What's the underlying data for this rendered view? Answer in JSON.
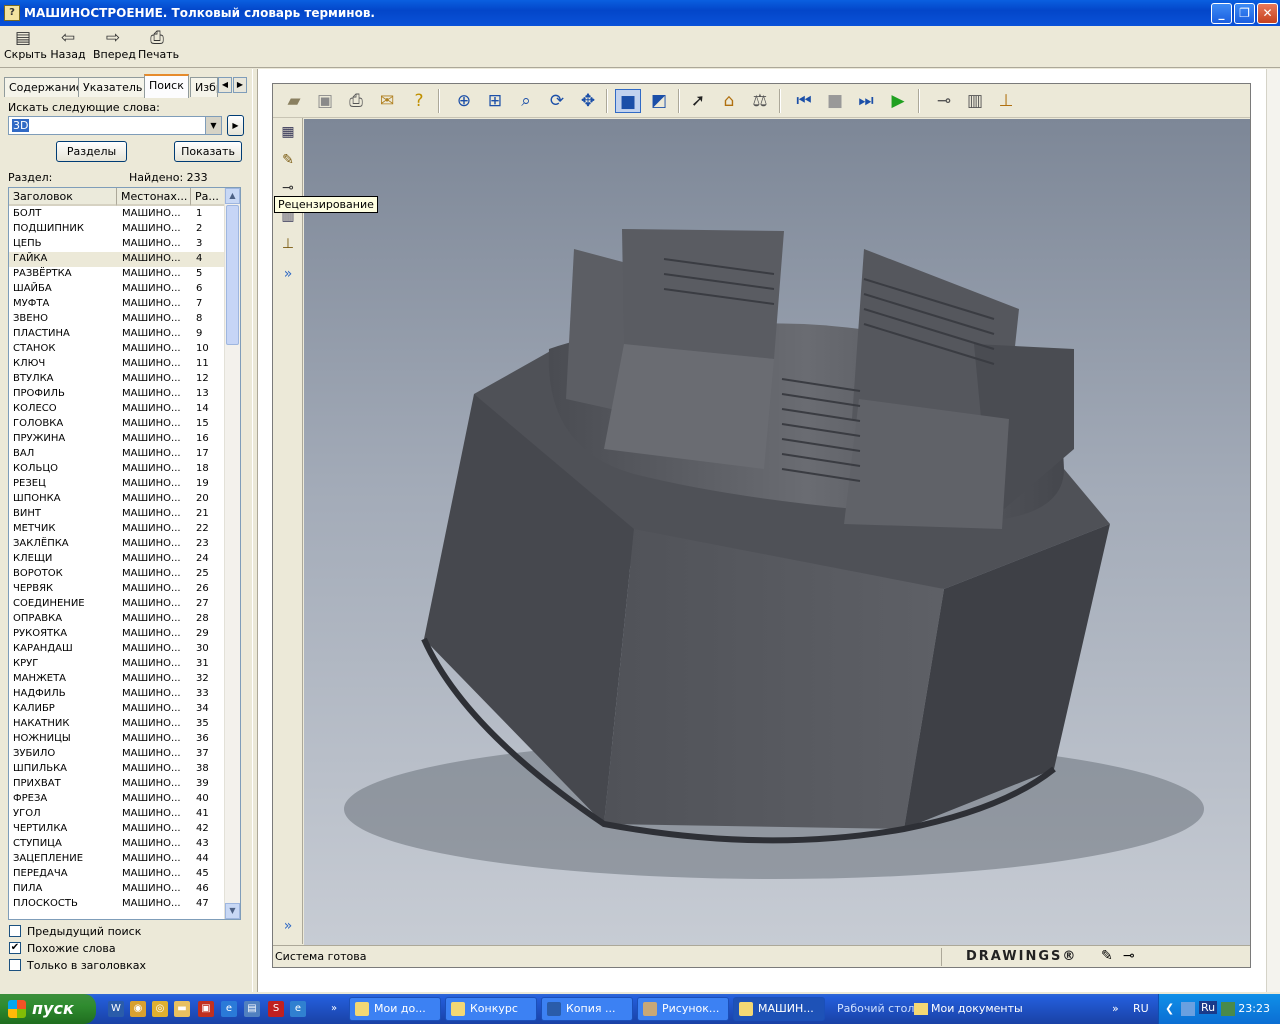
{
  "window": {
    "title": "МАШИНОСТРОЕНИЕ. Толковый словарь терминов.",
    "controls": {
      "minimize": "_",
      "maximize": "❐",
      "close": "✕"
    }
  },
  "toolbar": {
    "hide": "Скрыть",
    "back": "Назад",
    "forward": "Вперед",
    "print": "Печать"
  },
  "nav_tabs": [
    "Содержание",
    "Указатель",
    "Поиск",
    "Избр"
  ],
  "search": {
    "label": "Искать следующие слова:",
    "value": "3D",
    "sections_button": "Разделы",
    "show_button": "Показать",
    "section_label": "Раздел:",
    "found": "Найдено: 233"
  },
  "results": {
    "columns": [
      "Заголовок",
      "Местонах...",
      "Ра..."
    ],
    "selected_index": 3,
    "rows": [
      [
        "БОЛТ",
        "МАШИНО...",
        "1"
      ],
      [
        "ПОДШИПНИК",
        "МАШИНО...",
        "2"
      ],
      [
        "ЦЕПЬ",
        "МАШИНО...",
        "3"
      ],
      [
        "ГАЙКА",
        "МАШИНО...",
        "4"
      ],
      [
        "РАЗВЁРТКА",
        "МАШИНО...",
        "5"
      ],
      [
        "ШАЙБА",
        "МАШИНО...",
        "6"
      ],
      [
        "МУФТА",
        "МАШИНО...",
        "7"
      ],
      [
        "ЗВЕНО",
        "МАШИНО...",
        "8"
      ],
      [
        "ПЛАСТИНА",
        "МАШИНО...",
        "9"
      ],
      [
        "СТАНОК",
        "МАШИНО...",
        "10"
      ],
      [
        "КЛЮЧ",
        "МАШИНО...",
        "11"
      ],
      [
        "ВТУЛКА",
        "МАШИНО...",
        "12"
      ],
      [
        "ПРОФИЛЬ",
        "МАШИНО...",
        "13"
      ],
      [
        "КОЛЕСО",
        "МАШИНО...",
        "14"
      ],
      [
        "ГОЛОВКА",
        "МАШИНО...",
        "15"
      ],
      [
        "ПРУЖИНА",
        "МАШИНО...",
        "16"
      ],
      [
        "ВАЛ",
        "МАШИНО...",
        "17"
      ],
      [
        "КОЛЬЦО",
        "МАШИНО...",
        "18"
      ],
      [
        "РЕЗЕЦ",
        "МАШИНО...",
        "19"
      ],
      [
        "ШПОНКА",
        "МАШИНО...",
        "20"
      ],
      [
        "ВИНТ",
        "МАШИНО...",
        "21"
      ],
      [
        "МЕТЧИК",
        "МАШИНО...",
        "22"
      ],
      [
        "ЗАКЛЁПКА",
        "МАШИНО...",
        "23"
      ],
      [
        "КЛЕЩИ",
        "МАШИНО...",
        "24"
      ],
      [
        "ВОРОТОК",
        "МАШИНО...",
        "25"
      ],
      [
        "ЧЕРВЯК",
        "МАШИНО...",
        "26"
      ],
      [
        "СОЕДИНЕНИЕ",
        "МАШИНО...",
        "27"
      ],
      [
        "ОПРАВКА",
        "МАШИНО...",
        "28"
      ],
      [
        "РУКОЯТКА",
        "МАШИНО...",
        "29"
      ],
      [
        "КАРАНДАШ",
        "МАШИНО...",
        "30"
      ],
      [
        "КРУГ",
        "МАШИНО...",
        "31"
      ],
      [
        "МАНЖЕТА",
        "МАШИНО...",
        "32"
      ],
      [
        "НАДФИЛЬ",
        "МАШИНО...",
        "33"
      ],
      [
        "КАЛИБР",
        "МАШИНО...",
        "34"
      ],
      [
        "НАКАТНИК",
        "МАШИНО...",
        "35"
      ],
      [
        "НОЖНИЦЫ",
        "МАШИНО...",
        "36"
      ],
      [
        "ЗУБИЛО",
        "МАШИНО...",
        "37"
      ],
      [
        "ШПИЛЬКА",
        "МАШИНО...",
        "38"
      ],
      [
        "ПРИХВАТ",
        "МАШИНО...",
        "39"
      ],
      [
        "ФРЕЗА",
        "МАШИНО...",
        "40"
      ],
      [
        "УГОЛ",
        "МАШИНО...",
        "41"
      ],
      [
        "ЧЕРТИЛКА",
        "МАШИНО...",
        "42"
      ],
      [
        "СТУПИЦА",
        "МАШИНО...",
        "43"
      ],
      [
        "ЗАЦЕПЛЕНИЕ",
        "МАШИНО...",
        "44"
      ],
      [
        "ПЕРЕДАЧА",
        "МАШИНО...",
        "45"
      ],
      [
        "ПИЛА",
        "МАШИНО...",
        "46"
      ],
      [
        "ПЛОСКОСТЬ",
        "МАШИНО...",
        "47"
      ]
    ]
  },
  "options": {
    "previous_search": "Предыдущий поиск",
    "similar_words": "Похожие слова",
    "titles_only": "Только в заголовках",
    "previous_checked": false,
    "similar_checked": true,
    "titles_checked": false
  },
  "viewer": {
    "tooltip": "Рецензирование",
    "status": "Система готова",
    "brand": "DRAWINGS®"
  },
  "taskbar": {
    "start": "пуск",
    "tasks": [
      "Мои до...",
      "Конкурс",
      "Копия ...",
      "Рисунок...",
      "МАШИН..."
    ],
    "desk_label": "Рабочий стол",
    "docs_label": "Мои документы",
    "lang": "RU",
    "lang2": "Ru",
    "clock": "23:23"
  }
}
